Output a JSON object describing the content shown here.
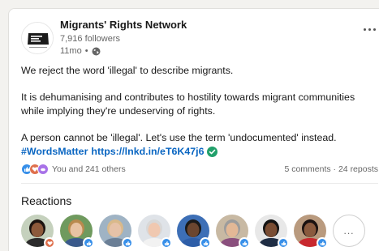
{
  "post": {
    "author": {
      "name": "Migrants' Rights Network",
      "followers": "7,916 followers",
      "time": "11mo",
      "separator": "•",
      "logo_text": "Migrants' Rights Network"
    },
    "paragraphs": [
      "We reject the word 'illegal' to describe migrants.",
      "It is dehumanising and contributes to hostility towards migrant communities while implying they're undeserving of rights.",
      "A person cannot be 'illegal'. Let's use the term 'undocumented' instead."
    ],
    "hashtag": "#WordsMatter",
    "link": "https://lnkd.in/eT6K47j6"
  },
  "social": {
    "reactors_text": "You and 241 others",
    "comments": "5 comments",
    "separator": "·",
    "reposts": "24 reposts",
    "reaction_types": [
      "like-icon",
      "love-icon",
      "support-icon"
    ]
  },
  "reactions": {
    "title": "Reactions",
    "more_label": "...",
    "people": [
      {
        "reaction": "love",
        "skin": "#8d5a3b",
        "hair": "#1c1410",
        "shirt": "#2b2b2b",
        "bg": "#c5d1bd"
      },
      {
        "reaction": "like",
        "skin": "#e8c3a3",
        "hair": "#b98a4e",
        "shirt": "#3a5a8c",
        "bg": "#6f9a5e"
      },
      {
        "reaction": "like",
        "skin": "#e6c2a8",
        "hair": "#d9b98a",
        "shirt": "#6b7f96",
        "bg": "#9fb3c4"
      },
      {
        "reaction": "like",
        "skin": "#f0c8b0",
        "hair": "#d8d8d8",
        "shirt": "#f2f2f2",
        "bg": "#dfe3e8"
      },
      {
        "reaction": "like",
        "skin": "#6b4630",
        "hair": "#1a1a1a",
        "shirt": "#2e5ea8",
        "bg": "#3d6fb6"
      },
      {
        "reaction": "like",
        "skin": "#e3b896",
        "hair": "#9c9c9c",
        "shirt": "#8a4f7d",
        "bg": "#c8b9a3"
      },
      {
        "reaction": "like",
        "skin": "#7a4d33",
        "hair": "#141414",
        "shirt": "#1f2d44",
        "bg": "#e8e8e8"
      },
      {
        "reaction": "like",
        "skin": "#8a5a3e",
        "hair": "#1a1110",
        "shirt": "#c8282e",
        "bg": "#b99a7e"
      }
    ]
  }
}
